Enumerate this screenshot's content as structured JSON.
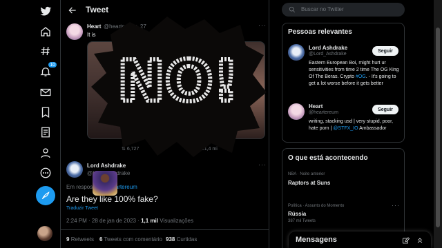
{
  "nav": {
    "notification_count": "10"
  },
  "header": {
    "title": "Tweet"
  },
  "original_tweet": {
    "name": "Heart",
    "handle": "@heartereum",
    "time": "· 27",
    "text_start": "It is",
    "stats": {
      "retweets": "6,727",
      "views": "21,4 mi"
    }
  },
  "overlay": {
    "text": "NO!"
  },
  "reply": {
    "name": "Lord Ashdrake",
    "handle": "@Lord_Ashdrake",
    "in_reply_prefix": "Em resposta a",
    "in_reply_handle": "@heartereum",
    "text": "Are they like 100% fake?",
    "translate": "Traduzir Tweet",
    "time": "2:24 PM · 28 de jan de 2023 ·",
    "views_count": "1,1 mil",
    "views_label": "Visualizações",
    "retweets_count": "9",
    "retweets_label": "Retweets",
    "quotes_count": "6",
    "quotes_label": "Tweets com comentário",
    "likes_count": "938",
    "likes_label": "Curtidas"
  },
  "search": {
    "placeholder": "Buscar no Twitter"
  },
  "relevant": {
    "title": "Pessoas relevantes",
    "people": [
      {
        "name": "Lord Ashdrake",
        "handle": "@Lord_Ashdrake",
        "follow": "Seguir",
        "bio_1": "Eastern European Boi, might hurt ur sensitivities from time 2 time The OG King Of The Beras. Crypto ",
        "bio_link": "#OG",
        "bio_2": ". - It's going to get a lot worse before it gets better"
      },
      {
        "name": "Heart",
        "handle": "@heartereum",
        "follow": "Seguir",
        "bio_1": "writing, stacking usd | very stupid, poor, hate porn | ",
        "bio_link": "@STFX_IO",
        "bio_2": " Ambassador"
      }
    ]
  },
  "trends": {
    "title": "O que está acontecendo",
    "items": [
      {
        "meta": "NBA · Noite anterior",
        "title": "Raptors at Suns",
        "sub": ""
      },
      {
        "meta": "Política · Assunto do Momento",
        "title": "Rússia",
        "sub": "387 mil Tweets"
      }
    ]
  },
  "messages": {
    "label": "Mensagens"
  }
}
